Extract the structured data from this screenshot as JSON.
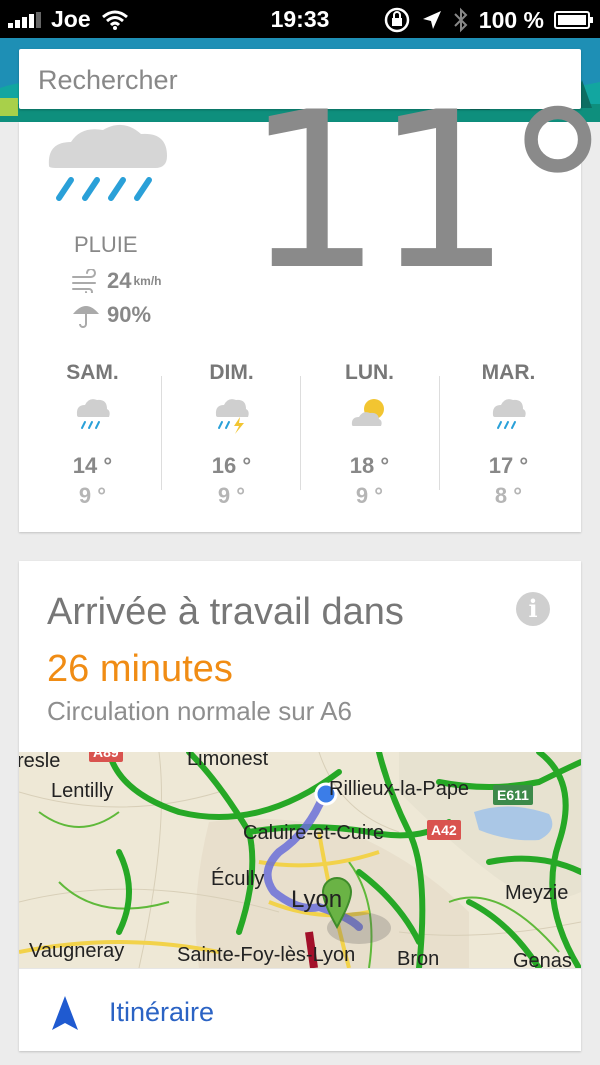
{
  "status_bar": {
    "carrier": "Joe",
    "time": "19:33",
    "battery": "100 %",
    "icons": [
      "signal-icon",
      "wifi-icon",
      "rotation-lock-icon",
      "location-icon",
      "bluetooth-icon",
      "battery-icon"
    ]
  },
  "search": {
    "placeholder": "Rechercher"
  },
  "weather": {
    "temperature": "11°",
    "condition": "PLUIE",
    "wind": "24",
    "wind_unit": "km/h",
    "precipitation": "90%",
    "forecast": [
      {
        "day": "SAM.",
        "high": "14 °",
        "low": "9 °",
        "icon": "rain-icon"
      },
      {
        "day": "DIM.",
        "high": "16 °",
        "low": "9 °",
        "icon": "thunderstorm-icon"
      },
      {
        "day": "LUN.",
        "high": "18 °",
        "low": "9 °",
        "icon": "partly-sunny-icon"
      },
      {
        "day": "MAR.",
        "high": "17 °",
        "low": "8 °",
        "icon": "rain-icon"
      }
    ]
  },
  "commute": {
    "title": "Arrivée à travail dans",
    "duration": "26 minutes",
    "traffic": "Circulation normale sur A6",
    "route_label": "Itinéraire",
    "map_places": [
      "resle",
      "Limonest",
      "Lentilly",
      "Rillieux-la-Pape",
      "Caluire-et-Cuire",
      "Écully",
      "Lyon",
      "Meyzie",
      "Vaugneray",
      "Sainte-Foy-lès-Lyon",
      "Bron",
      "Genas"
    ],
    "map_roads": [
      "A89",
      "E611",
      "A42"
    ]
  },
  "colors": {
    "accent_orange": "#f08c14",
    "link_blue": "#2b63c4",
    "header_blue": "#1e8fb5"
  }
}
